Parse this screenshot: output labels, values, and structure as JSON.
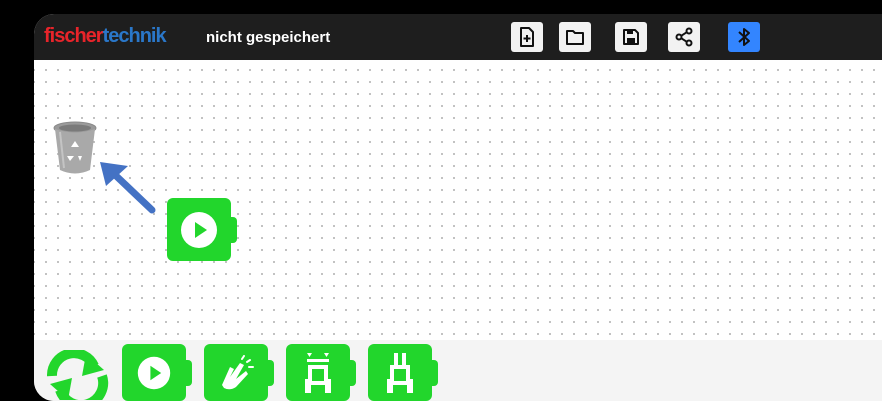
{
  "header": {
    "logo_part1": "fischer",
    "logo_part2": "technik",
    "document_status": "nicht gespeichert"
  },
  "toolbar": {
    "buttons": [
      {
        "name": "new-file",
        "icon": "file-plus-icon"
      },
      {
        "name": "open-folder",
        "icon": "folder-icon"
      },
      {
        "name": "save",
        "icon": "floppy-disk-icon"
      },
      {
        "name": "share",
        "icon": "share-icon"
      },
      {
        "name": "bluetooth",
        "icon": "bluetooth-icon",
        "active_color": "#3385ff"
      }
    ]
  },
  "canvas": {
    "trash": {
      "icon": "recycle-bin-icon"
    },
    "hint_arrow": {
      "icon": "arrow-up-left-icon",
      "color": "#4472c4"
    },
    "blocks": [
      {
        "type": "start",
        "icon": "play-icon"
      }
    ]
  },
  "palette": {
    "sync_icon": "sync-arrows-icon",
    "blocks": [
      {
        "type": "start",
        "icon": "play-icon"
      },
      {
        "type": "sound",
        "icon": "clap-hands-icon"
      },
      {
        "type": "robot-sensor",
        "icon": "robot-sensor-icon"
      },
      {
        "type": "robot-drive",
        "icon": "robot-drive-icon"
      }
    ]
  },
  "colors": {
    "block_green": "#22d62c",
    "topbar": "#1e1e1e",
    "bluetooth_button": "#3385ff",
    "logo_red": "#e8242a",
    "logo_blue": "#2a77c9"
  }
}
